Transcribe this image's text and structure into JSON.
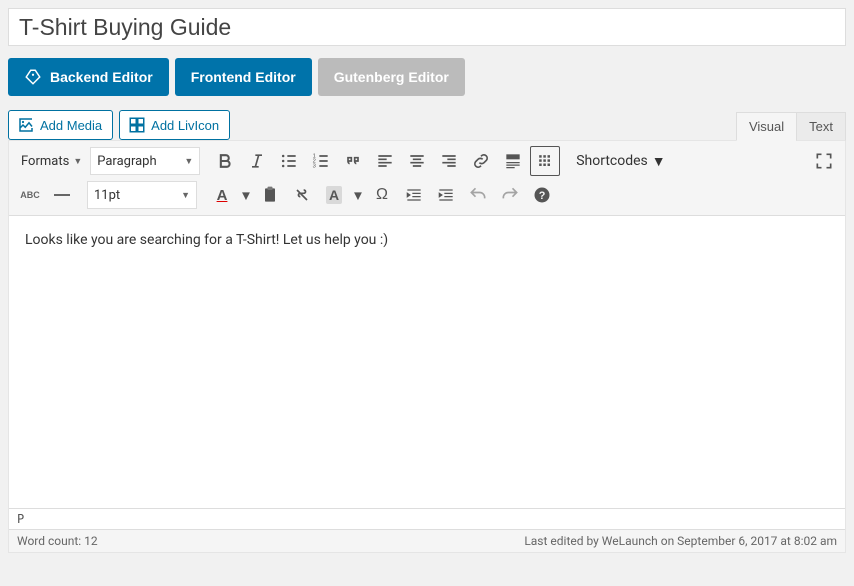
{
  "title": "T-Shirt Buying Guide",
  "editorTabs": {
    "backend": "Backend Editor",
    "frontend": "Frontend Editor",
    "gutenberg": "Gutenberg Editor"
  },
  "mediaButtons": {
    "addMedia": "Add Media",
    "addLivicon": "Add LivIcon"
  },
  "viewTabs": {
    "visual": "Visual",
    "text": "Text"
  },
  "toolbar": {
    "formats": "Formats",
    "paragraph": "Paragraph",
    "fontSize": "11pt",
    "shortcodes": "Shortcodes",
    "abc": "ABC"
  },
  "content": "Looks like you are searching for a T-Shirt! Let us help you :)",
  "path": "P",
  "footer": {
    "wordCount": "Word count: 12",
    "lastEdited": "Last edited by WeLaunch on September 6, 2017 at 8:02 am"
  }
}
